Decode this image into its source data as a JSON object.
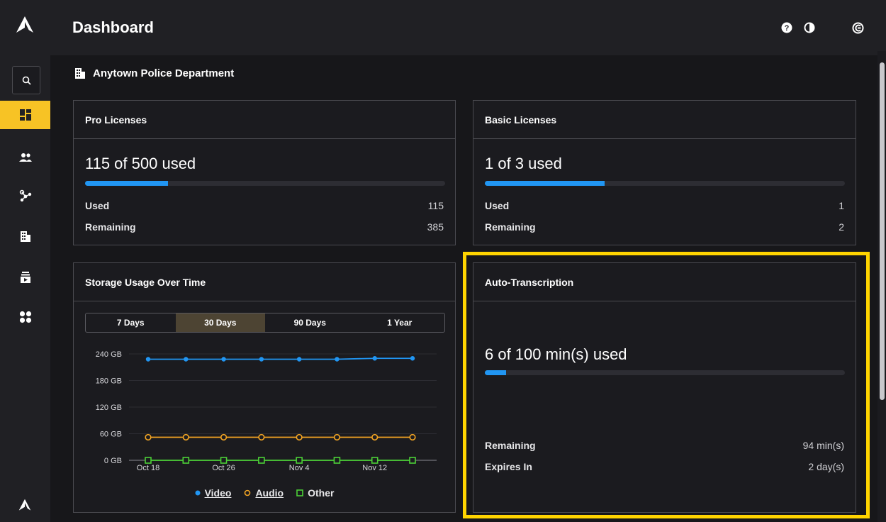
{
  "header": {
    "title": "Dashboard",
    "icons": [
      "help-icon",
      "contrast-icon",
      "account-icon"
    ]
  },
  "sidebar": {
    "items": [
      "search-icon",
      "dashboard-icon",
      "users-icon",
      "integrations-icon",
      "agency-icon",
      "devices-icon",
      "apps-icon"
    ]
  },
  "org": {
    "name": "Anytown Police Department"
  },
  "pro": {
    "title": "Pro Licenses",
    "summary": "115 of 500 used",
    "used_label": "Used",
    "used": "115",
    "remaining_label": "Remaining",
    "remaining": "385",
    "fraction": 0.23
  },
  "basic": {
    "title": "Basic Licenses",
    "summary": "1 of 3 used",
    "used_label": "Used",
    "used": "1",
    "remaining_label": "Remaining",
    "remaining": "2",
    "fraction": 0.333
  },
  "storage": {
    "title": "Storage Usage Over Time",
    "ranges": [
      "7 Days",
      "30 Days",
      "90 Days",
      "1 Year"
    ],
    "selected_range": "30 Days"
  },
  "chart_data": {
    "type": "line",
    "x": [
      "Oct 18",
      "Oct 22",
      "Oct 26",
      "Oct 30",
      "Nov 4",
      "Nov 8",
      "Nov 12",
      "Nov 16"
    ],
    "x_tick_labels": [
      "Oct 18",
      "Oct 26",
      "Nov 4",
      "Nov 12"
    ],
    "y_ticks": [
      "0 GB",
      "60 GB",
      "120 GB",
      "180 GB",
      "240 GB"
    ],
    "ylim": [
      0,
      240
    ],
    "series": [
      {
        "name": "Video",
        "color": "#2196f3",
        "marker": "circle-filled",
        "values": [
          228,
          228,
          228,
          228,
          228,
          228,
          230,
          230
        ]
      },
      {
        "name": "Audio",
        "color": "#f5a623",
        "marker": "circle-open",
        "values": [
          52,
          52,
          52,
          52,
          52,
          52,
          52,
          52
        ]
      },
      {
        "name": "Other",
        "color": "#4cd137",
        "marker": "square-open",
        "values": [
          0,
          0,
          0,
          0,
          0,
          0,
          0,
          0
        ]
      }
    ],
    "legend": "bottom",
    "grid": true
  },
  "transcription": {
    "title": "Auto-Transcription",
    "summary": "6 of 100 min(s) used",
    "fraction": 0.06,
    "remaining_label": "Remaining",
    "remaining": "94 min(s)",
    "expires_label": "Expires In",
    "expires": "2 day(s)"
  }
}
